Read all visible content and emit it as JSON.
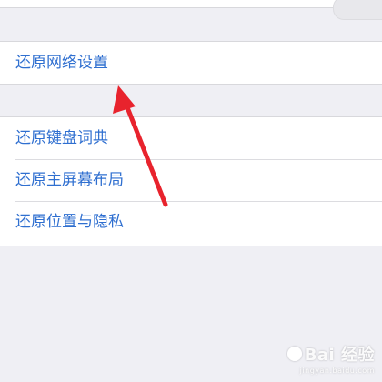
{
  "top_group": {
    "items": [
      {
        "label": "还原网络设置"
      }
    ]
  },
  "second_group": {
    "items": [
      {
        "label": "还原键盘词典"
      },
      {
        "label": "还原主屏幕布局"
      },
      {
        "label": "还原位置与隐私"
      }
    ]
  },
  "annotation": {
    "arrow_color": "#e8232d",
    "icon": "red-arrow"
  },
  "colors": {
    "background": "#efeff4",
    "cell_background": "#ffffff",
    "cell_text": "#2f6fd0"
  },
  "watermark": {
    "main": "Bai 经验",
    "sub": "jingyan.baidu.com"
  }
}
